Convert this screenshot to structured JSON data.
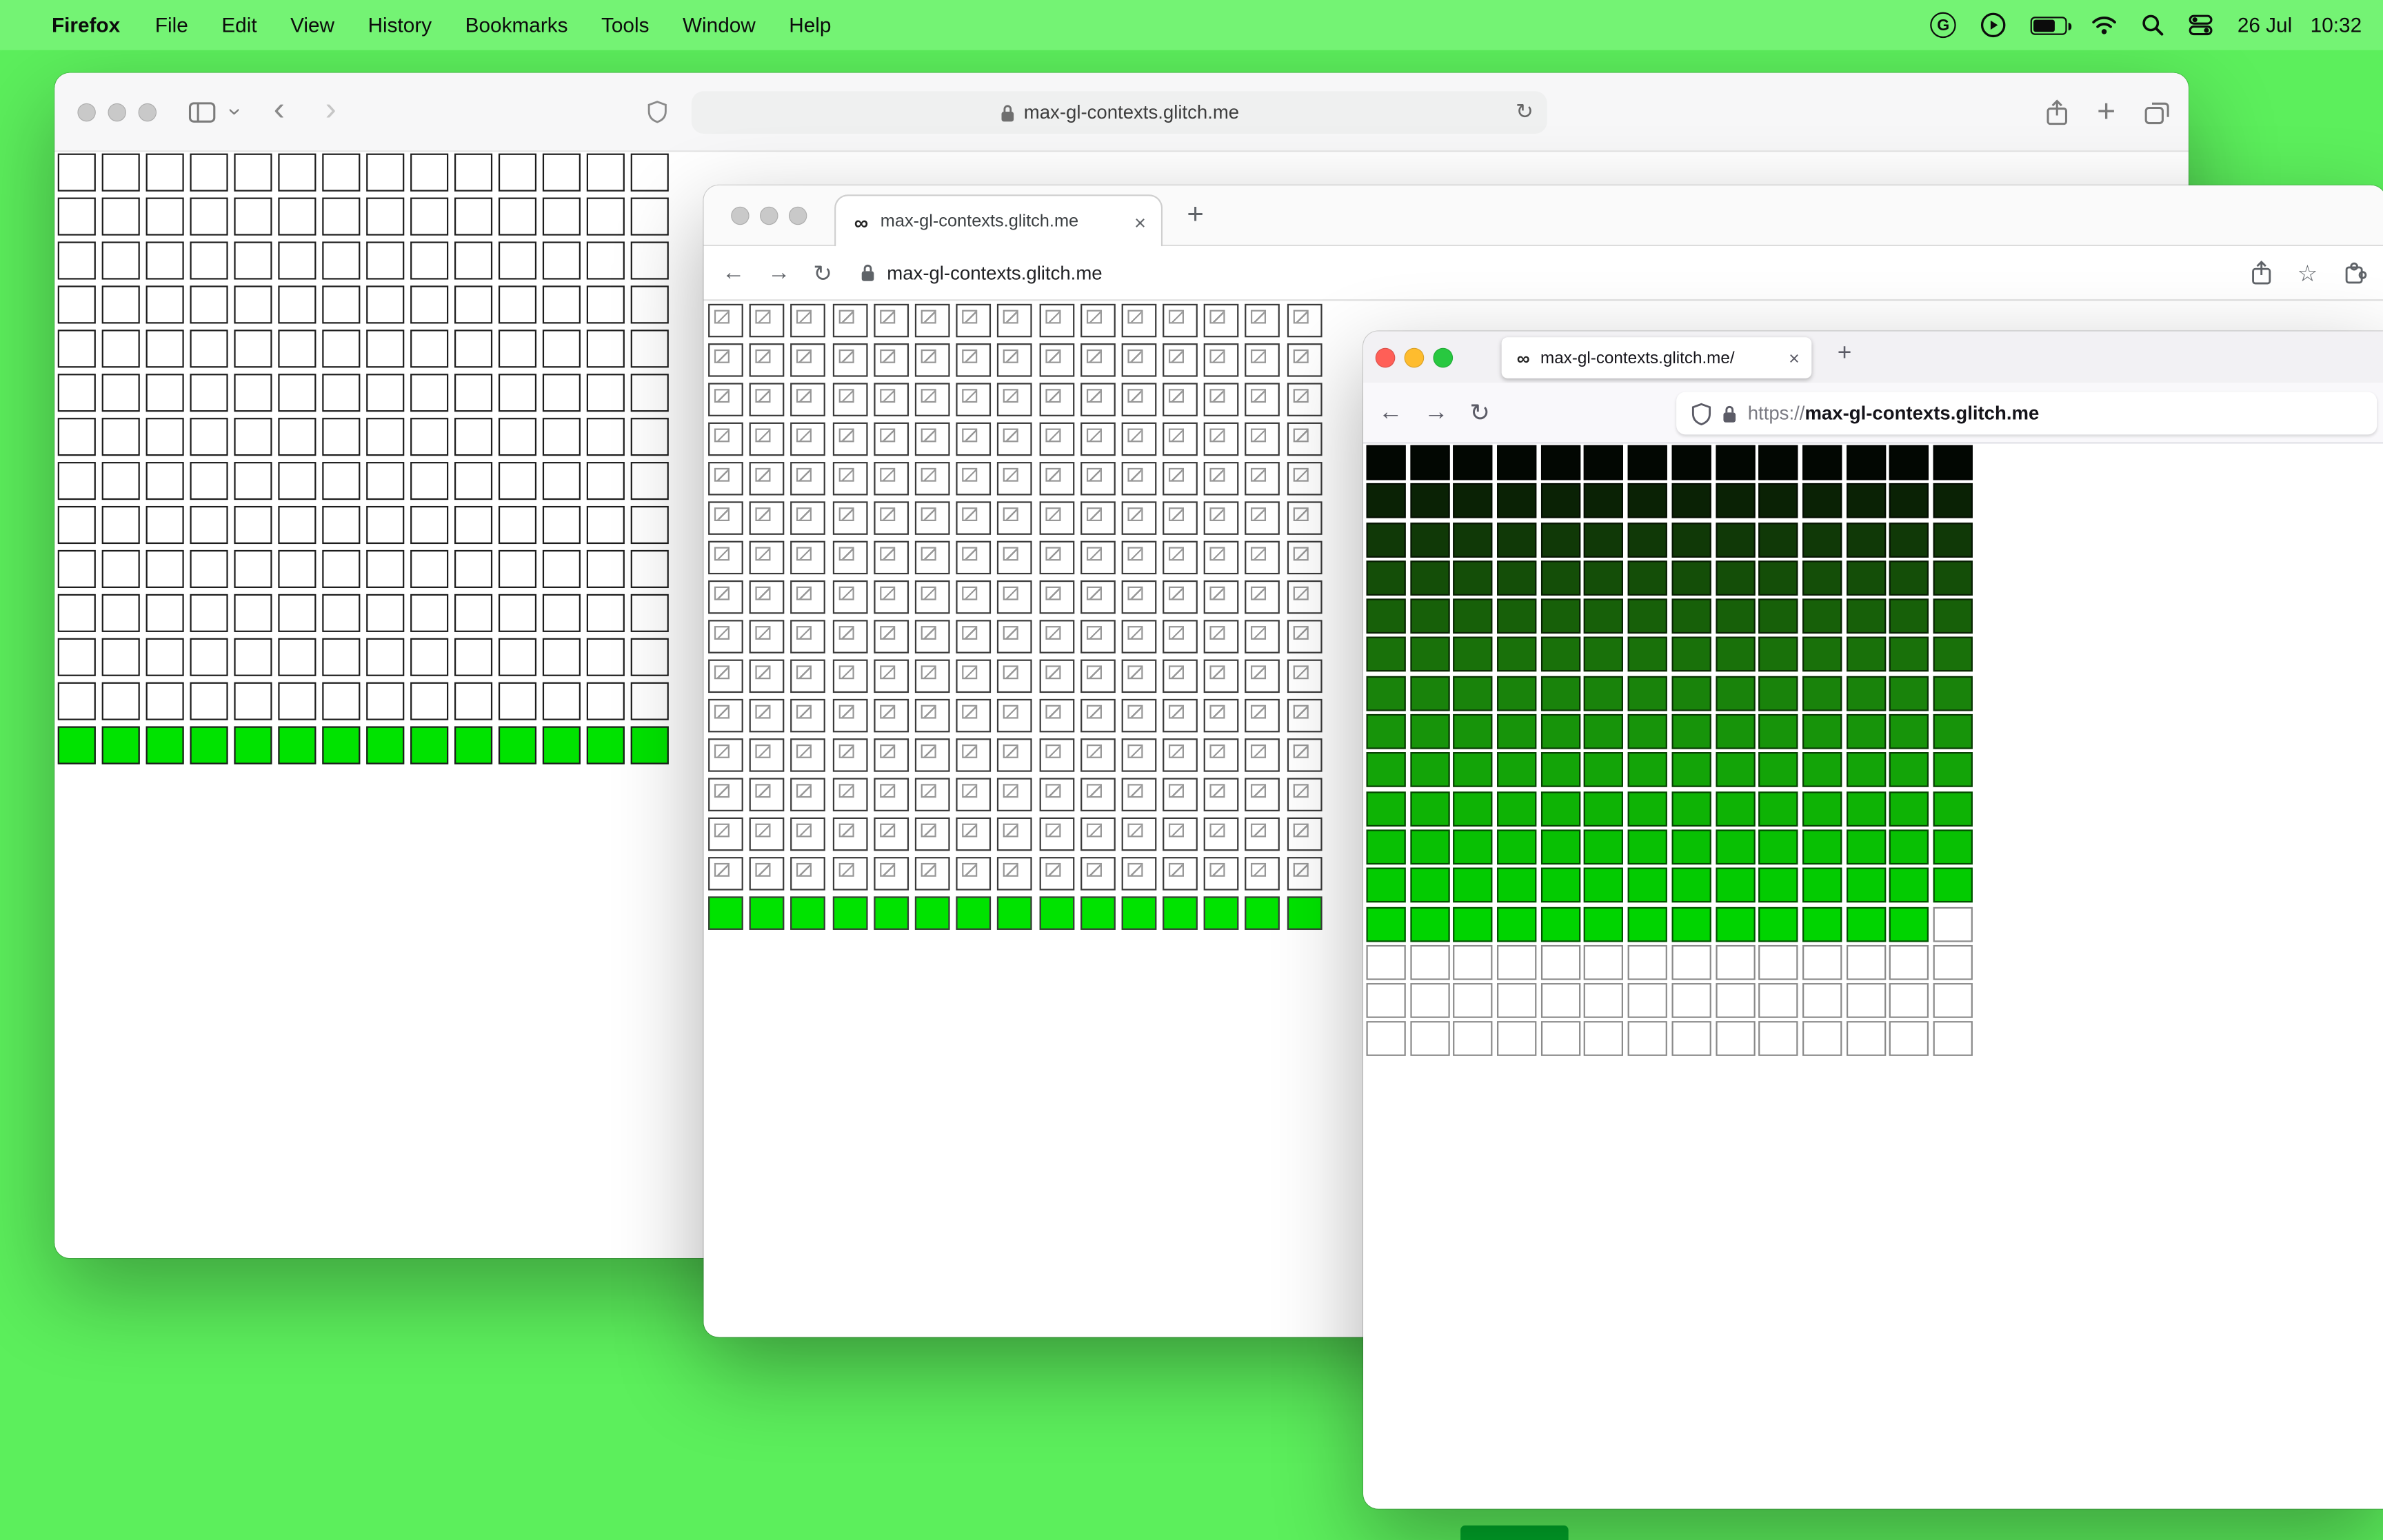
{
  "menu_bar": {
    "apple_logo": "",
    "app_name": "Firefox",
    "items": [
      "File",
      "Edit",
      "View",
      "History",
      "Bookmarks",
      "Tools",
      "Window",
      "Help"
    ],
    "g_label": "G",
    "date": "26 Jul",
    "time": "10:32"
  },
  "colors": {
    "desktop": "#5cef5c",
    "lime_row": "#00e300"
  },
  "glyphs": {
    "back_chevron": "‹",
    "forward_chevron": "›",
    "back_arrow": "←",
    "forward_arrow": "→",
    "reload": "↻",
    "plus": "+",
    "close": "×",
    "star": "☆",
    "infinity_favicon": "∞"
  },
  "safari": {
    "url": "max-gl-contexts.glitch.me",
    "grid": {
      "cols": 14,
      "rows": [
        {
          "type": "empty",
          "count": 13
        },
        {
          "type": "filled",
          "count": 1,
          "color": "#00e300"
        }
      ]
    }
  },
  "chrome": {
    "tab_title": "max-gl-contexts.glitch.me",
    "url": "max-gl-contexts.glitch.me",
    "grid": {
      "cols": 15,
      "rows": [
        {
          "type": "broken",
          "count": 15
        },
        {
          "type": "filled",
          "count": 1,
          "color": "#00e300"
        }
      ]
    }
  },
  "firefox": {
    "tab_title": "max-gl-contexts.glitch.me/",
    "url_scheme": "https://",
    "url_host": "max-gl-contexts.glitch.me",
    "grid": {
      "cols": 14,
      "rows": [
        {
          "type": "gradient",
          "colors": [
            "#020702",
            "#0a2205",
            "#103907",
            "#144e08",
            "#176009",
            "#19710a",
            "#19830b",
            "#17940a",
            "#13a408",
            "#0eb305",
            "#08c003",
            "#03cb01"
          ]
        },
        {
          "type": "partial",
          "color": "#00d400",
          "filled": 13,
          "emptyBorder": "#8a8a8a"
        },
        {
          "type": "empty",
          "count": 3,
          "cellBorder": "#8a8a8a"
        }
      ]
    }
  }
}
